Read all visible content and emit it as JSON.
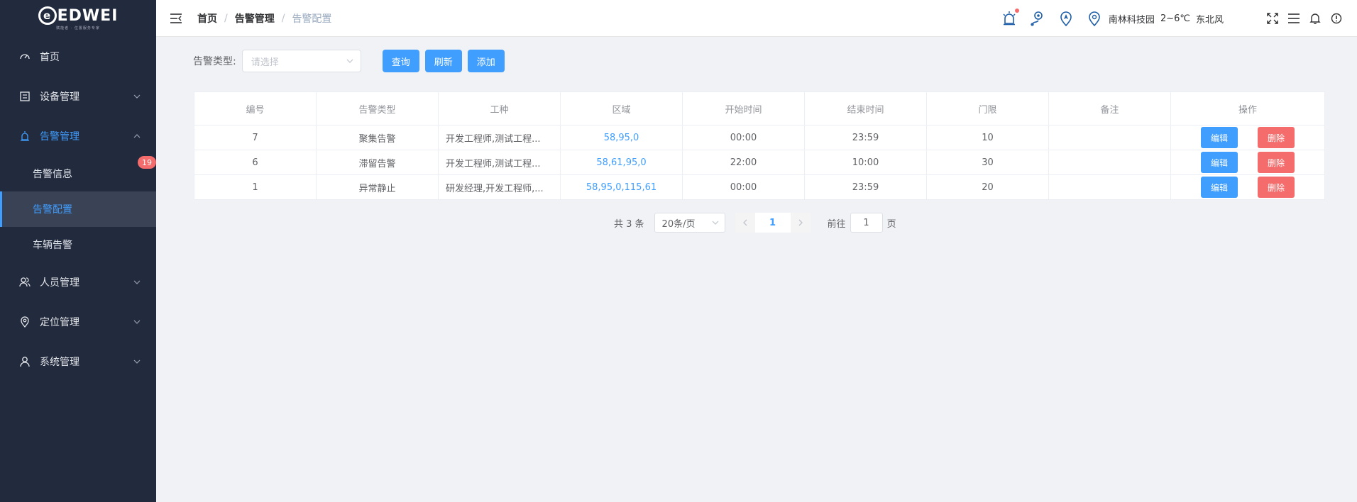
{
  "logo": {
    "text": "EDWEI",
    "subtitle": "赋能者 · 位置服务专家"
  },
  "sidebar": {
    "items": [
      {
        "label": "首页"
      },
      {
        "label": "设备管理"
      },
      {
        "label": "告警管理"
      },
      {
        "label": "人员管理"
      },
      {
        "label": "定位管理"
      },
      {
        "label": "系统管理"
      }
    ],
    "alarm_sub": [
      {
        "label": "告警信息",
        "badge": "19"
      },
      {
        "label": "告警配置"
      },
      {
        "label": "车辆告警"
      }
    ]
  },
  "header": {
    "breadcrumb": [
      "首页",
      "告警管理",
      "告警配置"
    ],
    "location": "南林科技园",
    "temperature": "2~6℃",
    "wind": "东北风"
  },
  "filter": {
    "label": "告警类型:",
    "placeholder": "请选择",
    "query": "查询",
    "refresh": "刷新",
    "add": "添加"
  },
  "table": {
    "columns": [
      "编号",
      "告警类型",
      "工种",
      "区域",
      "开始时间",
      "结束时间",
      "门限",
      "备注",
      "操作"
    ],
    "rows": [
      {
        "id": "7",
        "type": "聚集告警",
        "job": "开发工程师,测试工程...",
        "area": "58,95,0",
        "start": "00:00",
        "end": "23:59",
        "threshold": "10",
        "remark": ""
      },
      {
        "id": "6",
        "type": "滞留告警",
        "job": "开发工程师,测试工程...",
        "area": "58,61,95,0",
        "start": "22:00",
        "end": "10:00",
        "threshold": "30",
        "remark": ""
      },
      {
        "id": "1",
        "type": "异常静止",
        "job": "研发经理,开发工程师,...",
        "area": "58,95,0,115,61",
        "start": "00:00",
        "end": "23:59",
        "threshold": "20",
        "remark": ""
      }
    ],
    "edit_label": "编辑",
    "delete_label": "删除"
  },
  "pager": {
    "total": "共 3 条",
    "page_size": "20条/页",
    "current": "1",
    "goto_prefix": "前往",
    "goto_value": "1",
    "goto_suffix": "页"
  },
  "colors": {
    "primary": "#409eff",
    "danger": "#f56c6c",
    "sidebar_bg": "#222a3d"
  }
}
